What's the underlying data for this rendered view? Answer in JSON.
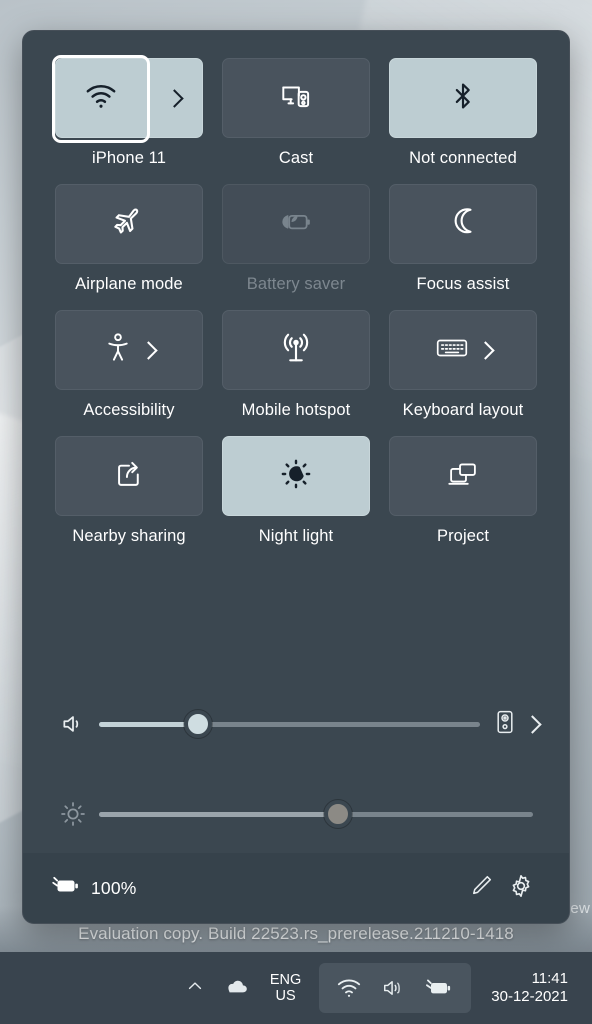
{
  "panel": {
    "name": "Quick Settings",
    "tiles": [
      [
        {
          "label": "iPhone 11",
          "icon": "wifi-icon",
          "state": "on",
          "split": true,
          "chevron": true,
          "name": "wifi"
        },
        {
          "label": "Cast",
          "icon": "cast-icon",
          "state": "off",
          "split": false,
          "chevron": false,
          "name": "cast"
        },
        {
          "label": "Not connected",
          "icon": "bluetooth-icon",
          "state": "on",
          "split": false,
          "chevron": false,
          "name": "bluetooth"
        }
      ],
      [
        {
          "label": "Airplane mode",
          "icon": "airplane-icon",
          "state": "off",
          "split": false,
          "chevron": false,
          "name": "airplane-mode"
        },
        {
          "label": "Battery saver",
          "icon": "battery-saver-icon",
          "state": "disabled",
          "split": false,
          "chevron": false,
          "name": "battery-saver"
        },
        {
          "label": "Focus assist",
          "icon": "moon-icon",
          "state": "off",
          "split": false,
          "chevron": false,
          "name": "focus-assist"
        }
      ],
      [
        {
          "label": "Accessibility",
          "icon": "accessibility-icon",
          "state": "off",
          "split": false,
          "chevron": true,
          "name": "accessibility"
        },
        {
          "label": "Mobile hotspot",
          "icon": "hotspot-icon",
          "state": "off",
          "split": false,
          "chevron": false,
          "name": "mobile-hotspot"
        },
        {
          "label": "Keyboard layout",
          "icon": "keyboard-icon",
          "state": "off",
          "split": false,
          "chevron": true,
          "name": "keyboard-layout"
        }
      ],
      [
        {
          "label": "Nearby sharing",
          "icon": "nearby-sharing-icon",
          "state": "off",
          "split": false,
          "chevron": false,
          "name": "nearby-sharing"
        },
        {
          "label": "Night light",
          "icon": "night-light-icon",
          "state": "on",
          "split": false,
          "chevron": false,
          "name": "night-light"
        },
        {
          "label": "Project",
          "icon": "project-icon",
          "state": "off",
          "split": false,
          "chevron": false,
          "name": "project"
        }
      ]
    ],
    "sliders": {
      "volume": {
        "icon": "speaker-icon",
        "value": 26,
        "output_icon": "audio-device-icon",
        "chevron": true,
        "state": "active"
      },
      "brightness": {
        "icon": "brightness-icon",
        "value": 55,
        "state": "disabled"
      }
    },
    "footer": {
      "battery_icon": "battery-charging-icon",
      "battery_level": "100%",
      "edit_icon": "pencil-icon",
      "settings_icon": "gear-icon"
    }
  },
  "desktop": {
    "watermark": "Evaluation copy. Build 22523.rs_prerelease.211210-1418",
    "watermark_right_fragment": "ew"
  },
  "taskbar": {
    "overflow_icon": "chevron-up-icon",
    "onedrive_icon": "cloud-icon",
    "language": {
      "line1": "ENG",
      "line2": "US"
    },
    "tray_group": [
      "wifi-icon",
      "volume-icon",
      "battery-charging-icon"
    ],
    "clock": {
      "time": "11:41",
      "date": "30-12-2021"
    }
  },
  "colors": {
    "panel_bg": "#3b4750",
    "tile_off": "#49535d",
    "tile_on": "#bdcdd2",
    "taskbar": "#39444e",
    "footer": "#36424b",
    "text": "#ffffff",
    "text_dim": "#7d878f"
  }
}
